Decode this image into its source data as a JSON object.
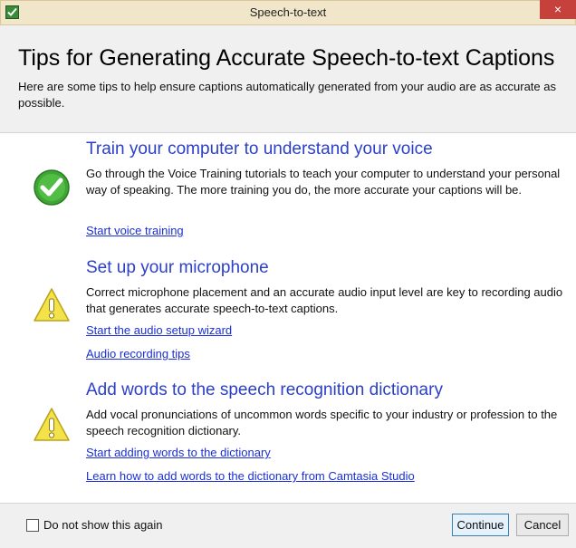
{
  "window": {
    "title": "Speech-to-text",
    "close_glyph": "×"
  },
  "header": {
    "title": "Tips for Generating Accurate Speech-to-text Captions",
    "subtitle": "Here are some tips to help ensure captions automatically generated from your audio are as accurate as possible."
  },
  "sections": [
    {
      "icon": "checkmark-icon",
      "title": "Train your computer to understand your voice",
      "body": "Go through the Voice Training tutorials to teach your computer to understand your personal way of speaking. The more training you do, the more accurate your captions will be.",
      "links": [
        "Start voice training"
      ]
    },
    {
      "icon": "warning-icon",
      "title": "Set up your microphone",
      "body": "Correct microphone placement and an accurate audio input level are key to recording audio that generates accurate speech-to-text captions.",
      "links": [
        "Start the audio setup wizard",
        "Audio recording tips"
      ]
    },
    {
      "icon": "warning-icon",
      "title": "Add words to the speech recognition dictionary",
      "body": "Add vocal pronunciations of uncommon words specific to your industry or profession to the speech recognition dictionary.",
      "links": [
        "Start adding words to the dictionary",
        "Learn how to add words to the dictionary from Camtasia Studio"
      ]
    }
  ],
  "footer": {
    "checkbox_label": "Do not show this again",
    "checkbox_checked": false,
    "continue_label": "Continue",
    "cancel_label": "Cancel"
  },
  "colors": {
    "titlebar": "#f1e6c9",
    "close_button": "#c7413c",
    "section_title": "#2b3fc8",
    "link": "#1a2fd6",
    "success_green": "#3fa535",
    "warning_yellow": "#f3e24a"
  }
}
